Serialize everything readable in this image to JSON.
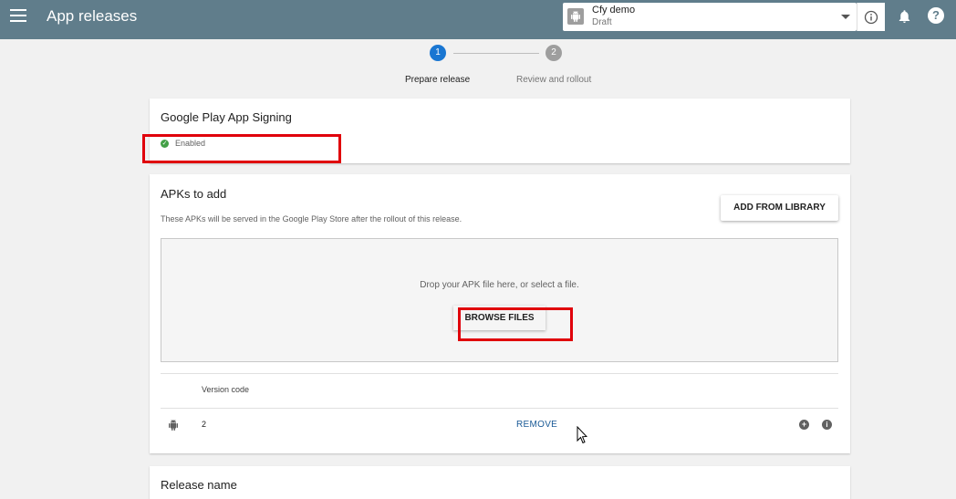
{
  "header": {
    "title": "App releases",
    "app_name": "Cfy demo",
    "app_status": "Draft"
  },
  "stepper": {
    "steps": [
      {
        "number": "1",
        "label": "Prepare release"
      },
      {
        "number": "2",
        "label": "Review and rollout"
      }
    ]
  },
  "signing": {
    "title": "Google Play App Signing",
    "status": "Enabled"
  },
  "apks": {
    "title": "APKs to add",
    "description": "These APKs will be served in the Google Play Store after the rollout of this release.",
    "add_from_library": "ADD FROM LIBRARY",
    "drop_text": "Drop your APK file here, or select a file.",
    "browse_files": "BROWSE FILES",
    "column_header": "Version code",
    "rows": [
      {
        "version_code": "2",
        "remove_label": "REMOVE"
      }
    ]
  },
  "release": {
    "title": "Release name"
  },
  "colors": {
    "topbar": "#607d8b",
    "step_active": "#1976d2",
    "highlight": "#e0000b",
    "link": "#1a5a96"
  }
}
